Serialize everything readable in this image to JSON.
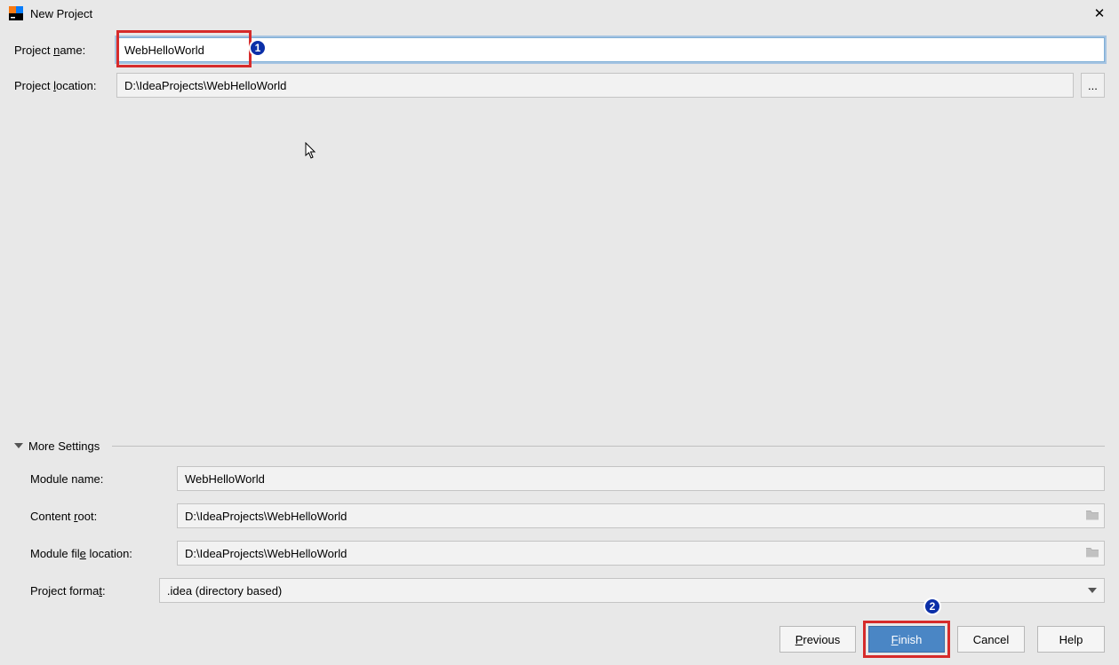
{
  "window": {
    "title": "New Project"
  },
  "labels": {
    "project_name_pre": "Project ",
    "project_name_u": "n",
    "project_name_post": "ame:",
    "project_loc_pre": "Project ",
    "project_loc_u": "l",
    "project_loc_post": "ocation:",
    "more_settings": "More Settings",
    "module_name": "Module name:",
    "content_root_pre": "Content ",
    "content_root_u": "r",
    "content_root_post": "oot:",
    "module_file_loc_pre": "Module fil",
    "module_file_loc_u": "e",
    "module_file_loc_post": " location:",
    "project_format_pre": "Project forma",
    "project_format_u": "t",
    "project_format_post": ":"
  },
  "fields": {
    "project_name": "WebHelloWorld",
    "project_location": "D:\\IdeaProjects\\WebHelloWorld",
    "module_name": "WebHelloWorld",
    "content_root": "D:\\IdeaProjects\\WebHelloWorld",
    "module_file_location": "D:\\IdeaProjects\\WebHelloWorld",
    "project_format": ".idea (directory based)"
  },
  "buttons": {
    "browse": "...",
    "previous_u": "P",
    "previous_rest": "revious",
    "finish_u": "F",
    "finish_rest": "inish",
    "cancel": "Cancel",
    "help": "Help"
  },
  "markers": {
    "one": "1",
    "two": "2"
  },
  "close": "✕"
}
